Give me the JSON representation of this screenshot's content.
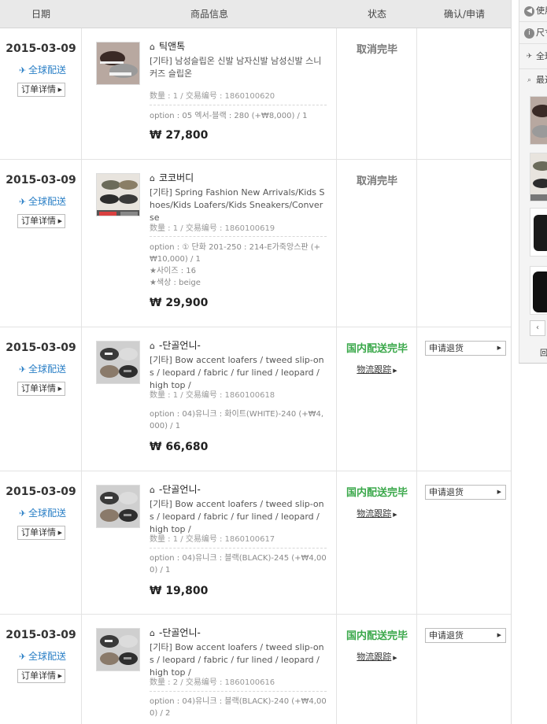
{
  "table": {
    "headers": {
      "date": "日期",
      "info": "商品信息",
      "status": "状态",
      "action": "确认/申请"
    }
  },
  "common": {
    "global_shipping": "全球配送",
    "order_detail": "订单详情",
    "tracking": "物流跟踪",
    "refund": "申请退货"
  },
  "orders": [
    {
      "date": "2015-03-09",
      "shop": "틱앤톡",
      "name": "[기타] 남성슬립온 신발 남자신발 남성신발 스니커즈 슬립온",
      "meta": "数量 : 1 / 交易编号 : 1860100620",
      "option": "option : 05 엑서-블랙 : 280 (+₩8,000) / 1",
      "price": "₩ 27,800",
      "status": "取消完毕",
      "status_type": "cancel"
    },
    {
      "date": "2015-03-09",
      "shop": "코코버디",
      "name": "[기타] Spring Fashion New Arrivals/Kids Shoes/Kids Loafers/Kids Sneakers/Converse",
      "meta": "数量 : 1 / 交易编号 : 1860100619",
      "option": "option : ① 단화 201-250 : 214-E가죽앙스판 (+₩10,000) / 1",
      "option2": "★사이즈 : 16",
      "option3": "★색상 : beige",
      "price": "₩ 29,900",
      "status": "取消完毕",
      "status_type": "cancel"
    },
    {
      "date": "2015-03-09",
      "shop": "-단골언니-",
      "name": "[기타] Bow accent loafers / tweed slip-ons / leopard / fabric / fur lined / leopard / high top /",
      "meta": "数量 : 1 / 交易编号 : 1860100618",
      "option": "option : 04)유니크 : 화이트(WHITE)-240 (+₩4,000) / 1",
      "price": "₩ 66,680",
      "status": "国内配送完毕",
      "status_type": "done"
    },
    {
      "date": "2015-03-09",
      "shop": "-단골언니-",
      "name": "[기타] Bow accent loafers / tweed slip-ons / leopard / fabric / fur lined / leopard / high top /",
      "meta": "数量 : 1 / 交易编号 : 1860100617",
      "option": "option : 04)유니크 : 블랙(BLACK)-245 (+₩4,000) / 1",
      "price": "₩ 19,800",
      "status": "国内配送完毕",
      "status_type": "done"
    },
    {
      "date": "2015-03-09",
      "shop": "-단골언니-",
      "name": "[기타] Bow accent loafers / tweed slip-ons / leopard / fabric / fur lined / leopard / high top /",
      "meta": "数量 : 2 / 交易编号 : 1860100616",
      "option": "option : 04)유니크 : 블랙(BLACK)-240 (+₩4,000) / 2",
      "price": "",
      "status": "国内配送完毕",
      "status_type": "done"
    }
  ],
  "side": {
    "item1": "使用",
    "item2": "尺寸",
    "item3": "全球",
    "item4": "最近",
    "prev": "‹",
    "foot": "回"
  },
  "colors": {
    "done": "#3aa84a",
    "cancel": "#777777",
    "ship": "#2a7fc6"
  }
}
